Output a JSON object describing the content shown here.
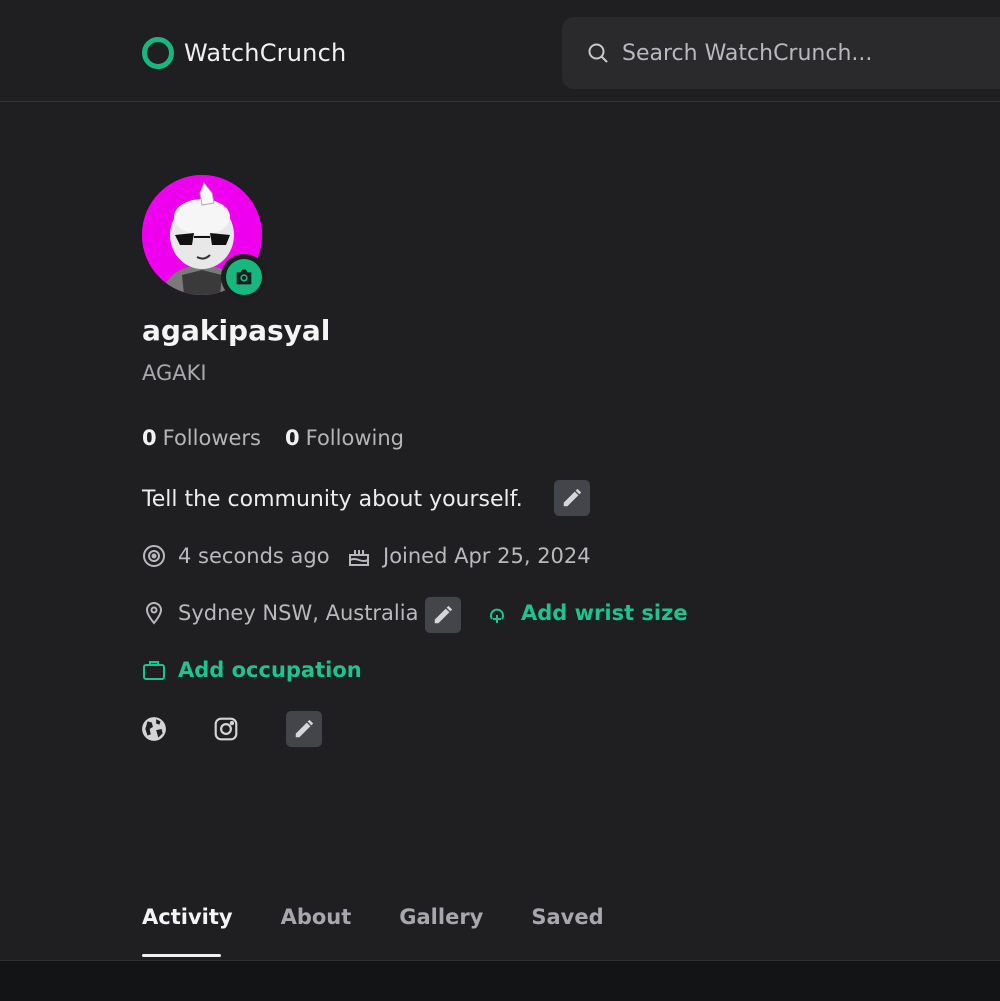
{
  "header": {
    "brand": "WatchCrunch",
    "search_placeholder": "Search WatchCrunch..."
  },
  "profile": {
    "username": "agakipasyal",
    "display_name": "AGAKI",
    "followers_count": "0",
    "followers_label": "Followers",
    "following_count": "0",
    "following_label": "Following",
    "bio": "Tell the community about yourself.",
    "last_seen": "4 seconds ago",
    "joined": "Joined Apr 25, 2024",
    "location": "Sydney NSW, Australia",
    "add_wrist_size": "Add wrist size",
    "add_occupation": "Add occupation"
  },
  "tabs": [
    {
      "label": "Activity",
      "active": true
    },
    {
      "label": "About",
      "active": false
    },
    {
      "label": "Gallery",
      "active": false
    },
    {
      "label": "Saved",
      "active": false
    }
  ],
  "colors": {
    "accent": "#17b87f",
    "background": "#1f1f21",
    "avatar_bg": "#ee00ee"
  },
  "icons": [
    "search-icon",
    "camera-icon",
    "pencil-icon",
    "activity-icon",
    "cake-icon",
    "location-pin-icon",
    "wrist-icon",
    "briefcase-icon",
    "globe-icon",
    "instagram-icon"
  ]
}
